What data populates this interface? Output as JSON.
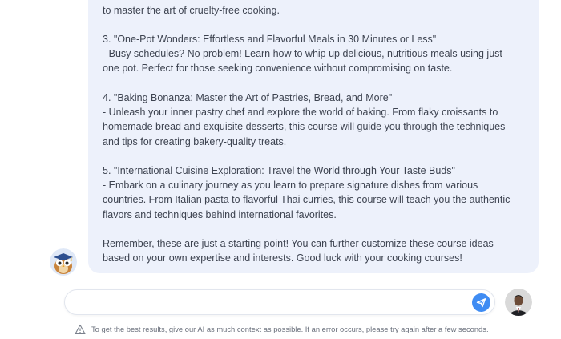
{
  "chat": {
    "response_lines": [
      "to master the art of cruelty-free cooking.",
      "",
      "3. \"One-Pot Wonders: Effortless and Flavorful Meals in 30 Minutes or Less\"",
      "- Busy schedules? No problem! Learn how to whip up delicious, nutritious meals using just",
      "one pot. Perfect for those seeking convenience without compromising on taste.",
      "",
      "4. \"Baking Bonanza: Master the Art of Pastries, Bread, and More\"",
      "- Unleash your inner pastry chef and explore the world of baking. From flaky croissants to",
      "homemade bread and exquisite desserts, this course will guide you through the techniques",
      "and tips for creating bakery-quality treats.",
      "",
      "5. \"International Cuisine Exploration: Travel the World through Your Taste Buds\"",
      "- Embark on a culinary journey as you learn to prepare signature dishes from various",
      "countries. From Italian pasta to flavorful Thai curries, this course will teach you the authentic",
      "flavors and techniques behind international favorites.",
      "",
      "Remember, these are just a starting point! You can further customize these course ideas",
      "based on your own expertise and interests. Good luck with your cooking courses!"
    ]
  },
  "composer": {
    "value": "",
    "placeholder": ""
  },
  "footer": {
    "disclaimer": "To get the best results, give our AI as much context as possible. If an error occurs, please try again after a few seconds."
  },
  "icons": {
    "send": "send-icon",
    "warning": "warning-icon",
    "bot_avatar": "owl-avatar",
    "user_avatar": "user-avatar"
  },
  "colors": {
    "bubble_bg": "#edf1fb",
    "send_button": "#3f8cf3",
    "text": "#3d4350"
  }
}
